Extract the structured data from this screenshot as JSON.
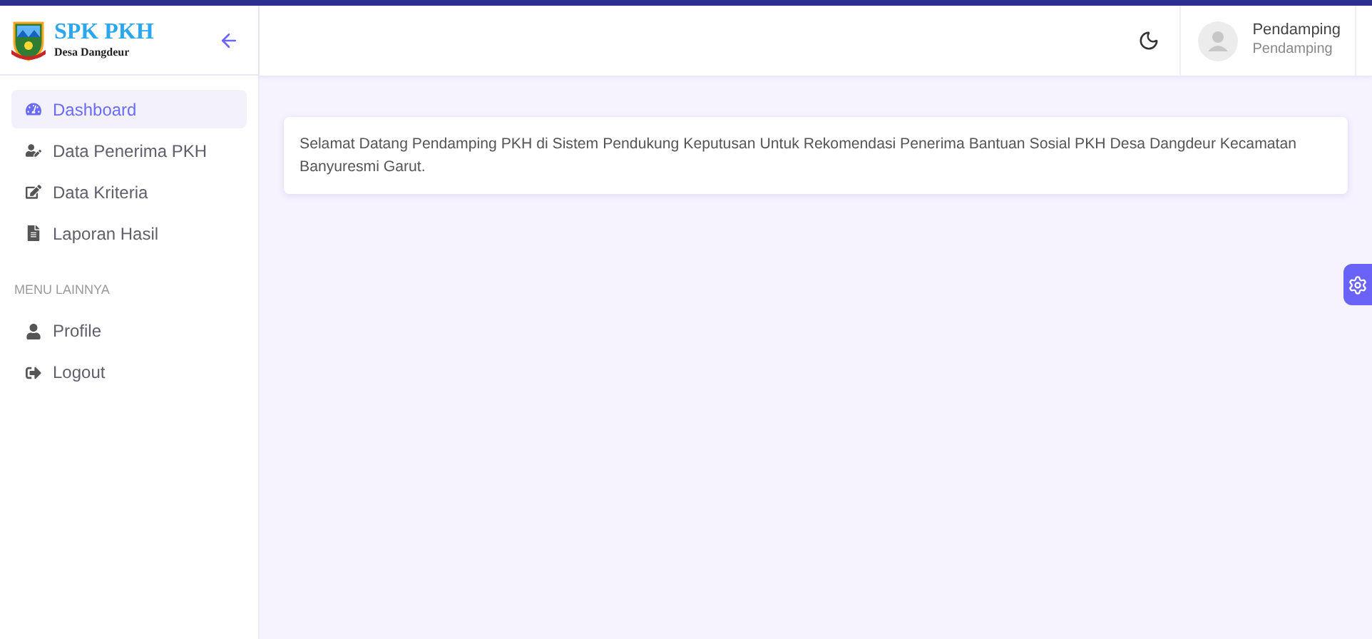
{
  "brand": {
    "title": "SPK PKH",
    "subtitle": "Desa Dangdeur"
  },
  "sidebar": {
    "items": [
      {
        "kind": "link",
        "label": "Dashboard",
        "selected": true
      },
      {
        "kind": "link",
        "label": "Data Penerima PKH",
        "selected": false
      },
      {
        "kind": "link",
        "label": "Data Kriteria",
        "selected": false
      },
      {
        "kind": "link",
        "label": "Laporan Hasil",
        "selected": false
      },
      {
        "kind": "heading",
        "label": "MENU LAINNYA"
      },
      {
        "kind": "link",
        "label": "Profile",
        "selected": false
      },
      {
        "kind": "link",
        "label": "Logout",
        "selected": false
      }
    ]
  },
  "user": {
    "name": "Pendamping",
    "role": "Pendamping"
  },
  "welcome": "Selamat Datang Pendamping PKH di Sistem Pendukung Keputusan Untuk Rekomendasi Penerima Bantuan Sosial PKH Desa Dangdeur Kecamatan Banyuresmi Garut."
}
